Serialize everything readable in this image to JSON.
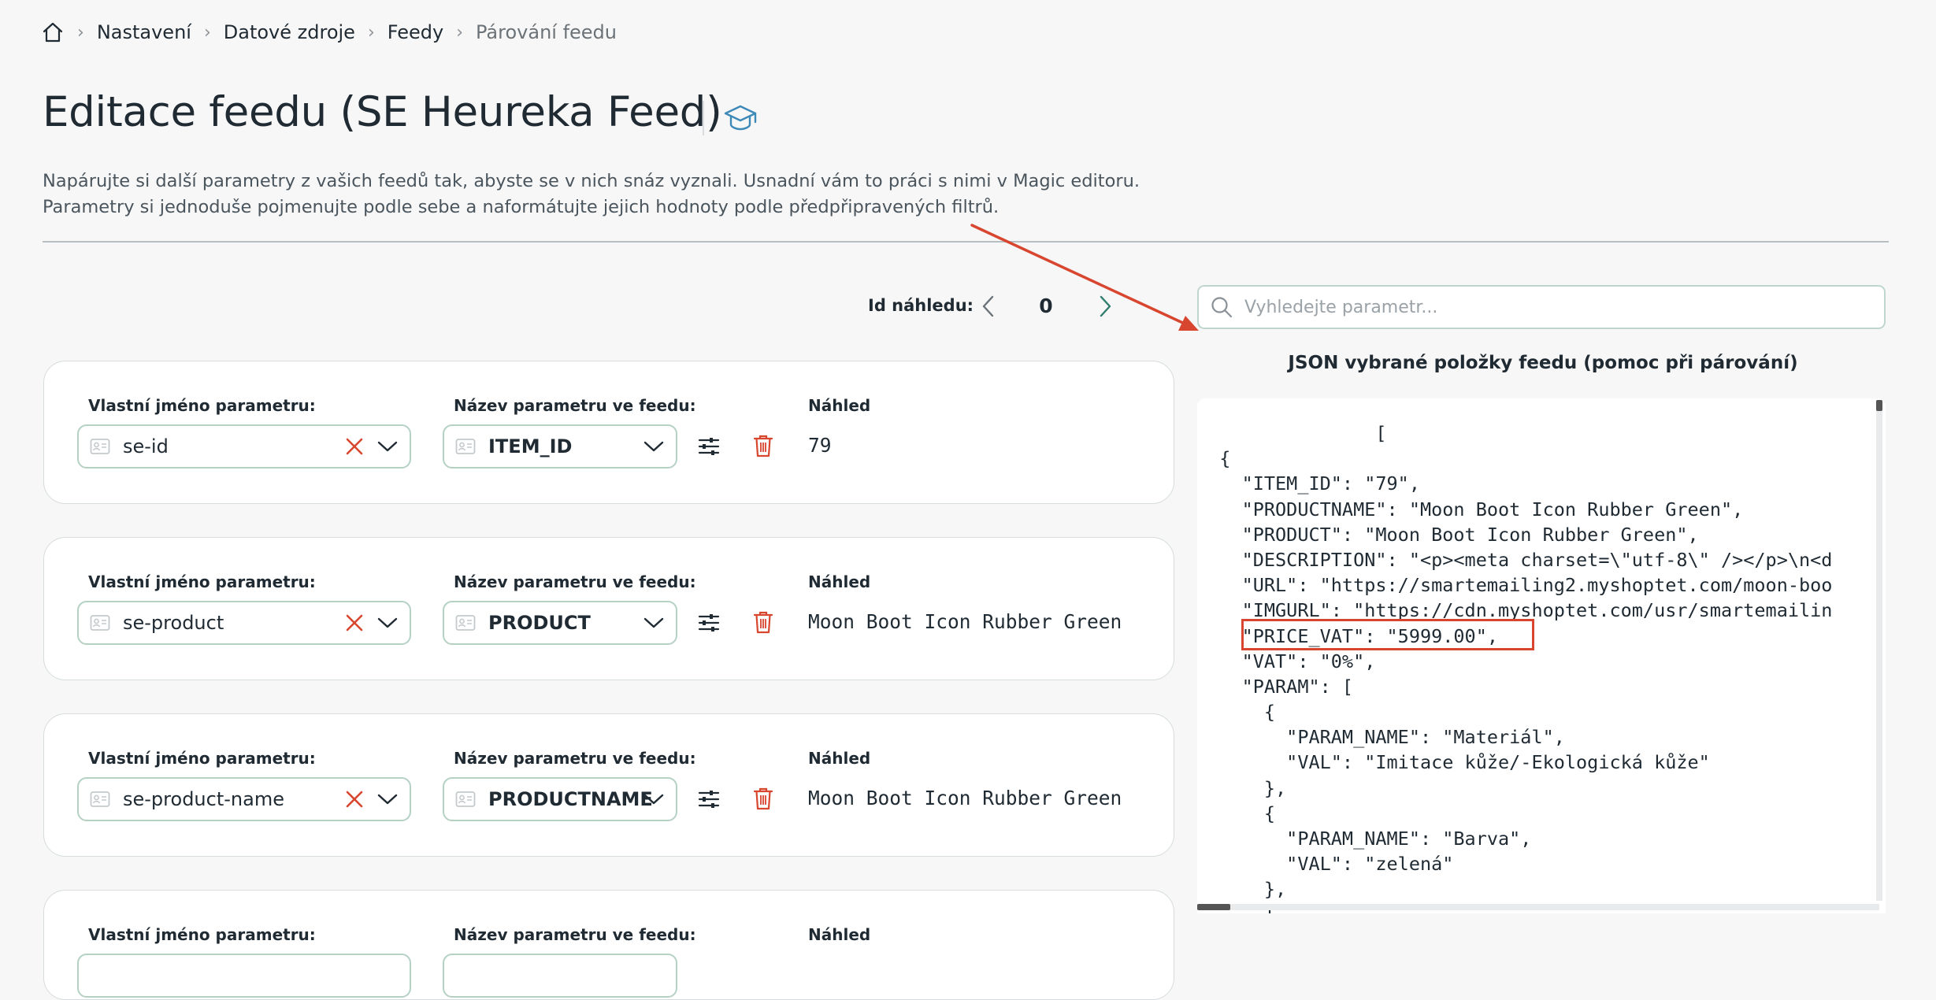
{
  "breadcrumb": {
    "items": [
      "Nastavení",
      "Datové zdroje",
      "Feedy"
    ],
    "current": "Párování feedu"
  },
  "page": {
    "title": "Editace feedu (SE Heureka Feed)",
    "intro_line1": "Napárujte si další parametry z vašich feedů tak, abyste se v nich snáz vyznali. Usnadní vám to práci s nimi v Magic editoru.",
    "intro_line2": "Parametry si jednoduše pojmenujte podle sebe a naformátujte jejich hodnoty podle předpřipravených filtrů."
  },
  "preview_id": {
    "label": "Id náhledu:",
    "value": "0"
  },
  "search": {
    "placeholder": "Vyhledejte parametr..."
  },
  "json_panel": {
    "title": "JSON vybrané položky feedu (pomoc při párování)",
    "lines": [
      "                [",
      "  {",
      "    \"ITEM_ID\": \"79\",",
      "    \"PRODUCTNAME\": \"Moon Boot Icon Rubber Green\",",
      "    \"PRODUCT\": \"Moon Boot Icon Rubber Green\",",
      "    \"DESCRIPTION\": \"<p><meta charset=\\\"utf-8\\\" /></p>\\n<d",
      "    \"URL\": \"https://smartemailing2.myshoptet.com/moon-boo",
      "    \"IMGURL\": \"https://cdn.myshoptet.com/usr/smartemailin",
      "    \"PRICE_VAT\": \"5999.00\",",
      "    \"VAT\": \"0%\",",
      "    \"PARAM\": [",
      "      {",
      "        \"PARAM_NAME\": \"Materiál\",",
      "        \"VAL\": \"Imitace kůže/-Ekologická kůže\"",
      "      },",
      "      {",
      "        \"PARAM_NAME\": \"Barva\",",
      "        \"VAL\": \"zelená\"",
      "      },",
      "      {"
    ]
  },
  "labels": {
    "custom_name": "Vlastní jméno parametru:",
    "feed_param": "Název parametru ve feedu:",
    "preview": "Náhled"
  },
  "params": [
    {
      "name": "se-id",
      "feed_param": "ITEM_ID",
      "preview": "79"
    },
    {
      "name": "se-product",
      "feed_param": "PRODUCT",
      "preview": "Moon Boot Icon Rubber Green"
    },
    {
      "name": "se-product-name",
      "feed_param": "PRODUCTNAME",
      "preview": "Moon Boot Icon Rubber Green"
    },
    {
      "name": "",
      "feed_param": "",
      "preview": ""
    }
  ],
  "colors": {
    "accent_green": "#2f7d6d",
    "remove_red": "#d8462f",
    "annotation_red": "#d8462f",
    "hat_blue": "#3d8ab8"
  }
}
